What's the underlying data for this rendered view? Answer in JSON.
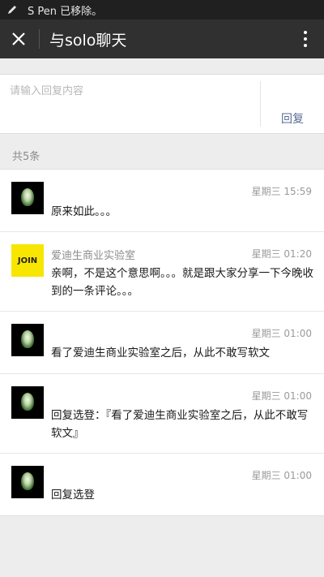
{
  "status": {
    "text": "S Pen 已移除。",
    "icon": "pen-icon"
  },
  "header": {
    "title": "与solo聊天",
    "close_icon": "close-icon",
    "more_icon": "more-vertical-icon"
  },
  "reply": {
    "placeholder": "请输入回复内容",
    "button": "回复"
  },
  "count_label": "共5条",
  "messages": [
    {
      "name": "",
      "time": "星期三 15:59",
      "text": "原来如此。。。",
      "avatar": "dark-photo"
    },
    {
      "name": "爱迪生商业实验室",
      "time": "星期三 01:20",
      "text": "亲啊，不是这个意思啊。。。就是跟大家分享一下今晚收到的一条评论。。。",
      "avatar": "join-logo",
      "avatar_text": "JOIN"
    },
    {
      "name": "",
      "time": "星期三 01:00",
      "text": "看了爱迪生商业实验室之后，从此不敢写软文",
      "avatar": "dark-photo"
    },
    {
      "name": "",
      "time": "星期三 01:00",
      "text": "回复选登：『看了爱迪生商业实验室之后，从此不敢写软文』",
      "avatar": "dark-photo"
    },
    {
      "name": "",
      "time": "星期三 01:00",
      "text": "回复选登",
      "avatar": "dark-photo"
    }
  ]
}
